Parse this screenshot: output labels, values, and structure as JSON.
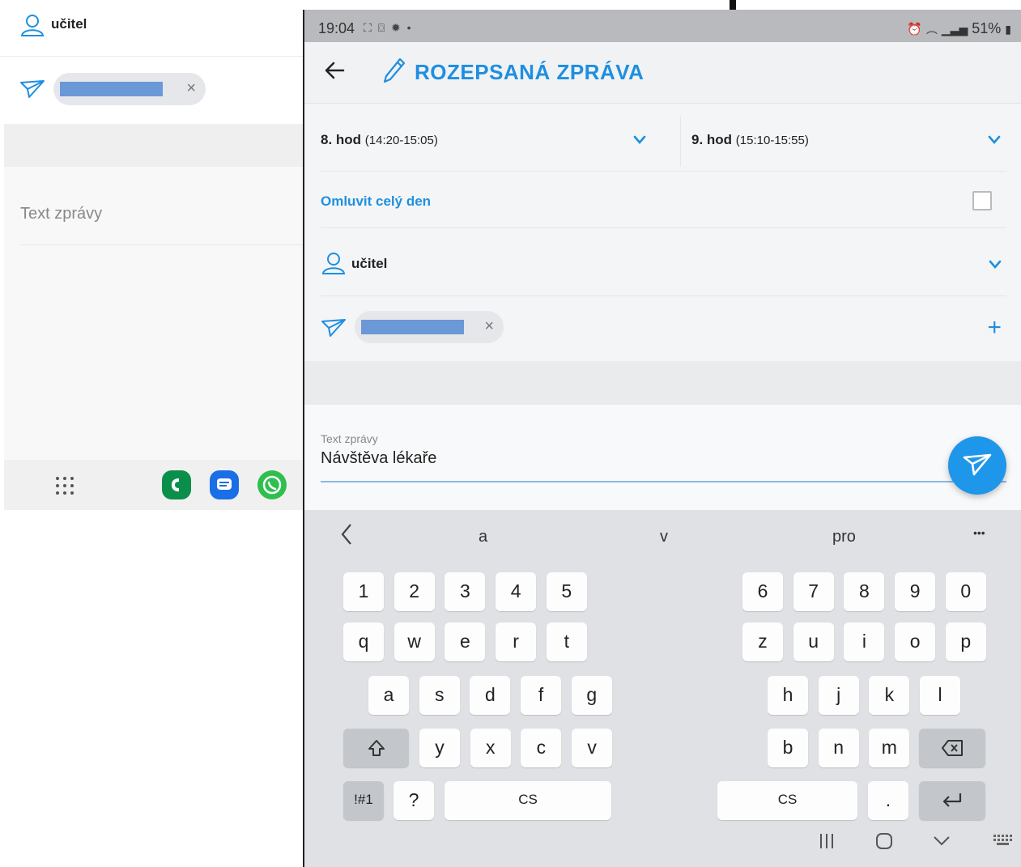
{
  "left_panel": {
    "teacher_label": "učitel",
    "recipient_chip_close": "×",
    "message_placeholder": "Text zprávy",
    "dock_icons": [
      "apps-grid-icon",
      "phone-app-icon",
      "messages-app-icon",
      "whatsapp-icon"
    ]
  },
  "status_bar": {
    "time": "19:04",
    "left_icons": "⛶ ⌼ ✹ •",
    "battery": "51%"
  },
  "app_bar": {
    "title": "ROZEPSANÁ ZPRÁVA"
  },
  "form": {
    "lesson_from": {
      "label": "8. hod",
      "time": "(14:20-15:05)"
    },
    "lesson_to": {
      "label": "9. hod",
      "time": "(15:10-15:55)"
    },
    "excuse_whole_day": "Omluvit celý den",
    "teacher": "učitel",
    "recipient_chip_close": "×",
    "add_recipient": "+"
  },
  "message": {
    "label": "Text zprávy",
    "value": "Návštěva lékaře"
  },
  "keyboard": {
    "suggestions": [
      "a",
      "v",
      "pro"
    ],
    "more": "•••",
    "row_numbers_left": [
      "1",
      "2",
      "3",
      "4",
      "5"
    ],
    "row_numbers_right": [
      "6",
      "7",
      "8",
      "9",
      "0"
    ],
    "row1_left": [
      "q",
      "w",
      "e",
      "r",
      "t"
    ],
    "row1_right": [
      "z",
      "u",
      "i",
      "o",
      "p"
    ],
    "row2_left": [
      "a",
      "s",
      "d",
      "f",
      "g"
    ],
    "row2_right": [
      "h",
      "j",
      "k",
      "l"
    ],
    "row3_left": [
      "y",
      "x",
      "c",
      "v"
    ],
    "row3_right": [
      "b",
      "n",
      "m"
    ],
    "symbols": "!#1",
    "question": "?",
    "space_left": "CS",
    "space_right": "CS",
    "period": "."
  },
  "colors": {
    "accent": "#1e8fe0",
    "fab": "#1e96ea",
    "chip_bar": "#6b98d6"
  }
}
